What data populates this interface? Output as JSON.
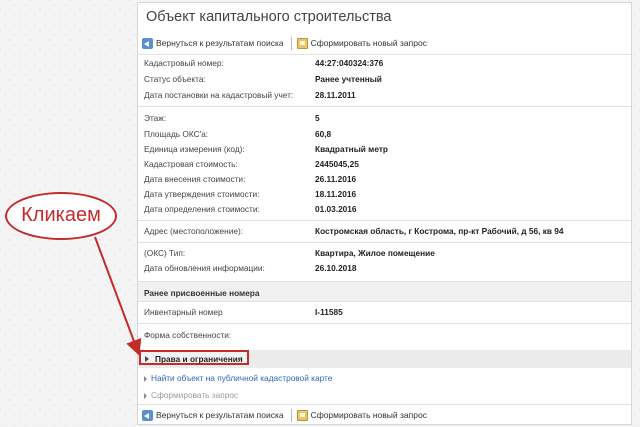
{
  "panel": {
    "title": "Объект капитального строительства"
  },
  "toolbar": {
    "back_label": "Вернуться к результатам поиска",
    "new_query_label": "Сформировать новый запрос"
  },
  "fields": {
    "cadastral_number": {
      "label": "Кадастровый номер:",
      "value": "44:27:040324:376"
    },
    "object_status": {
      "label": "Статус объекта:",
      "value": "Ранее учтенный"
    },
    "registration_date": {
      "label": "Дата постановки на кадастровый учет:",
      "value": "28.11.2011"
    },
    "floor": {
      "label": "Этаж:",
      "value": "5"
    },
    "area": {
      "label": "Площадь ОКС'a:",
      "value": "60,8"
    },
    "unit": {
      "label": "Единица измерения (код):",
      "value": "Квадратный метр"
    },
    "cadastral_value": {
      "label": "Кадастровая стоимость:",
      "value": "2445045,25"
    },
    "value_entry_date": {
      "label": "Дата внесения стоимости:",
      "value": "26.11.2016"
    },
    "value_approval_date": {
      "label": "Дата утверждения стоимости:",
      "value": "18.11.2016"
    },
    "value_determination_date": {
      "label": "Дата определения стоимости:",
      "value": "01.03.2016"
    },
    "address": {
      "label": "Адрес (местоположение):",
      "value": "Костромская область, г Кострома, пр-кт Рабочий, д 56, кв 94"
    },
    "oks_type": {
      "label": "(ОКС) Тип:",
      "value": "Квартира, Жилое помещение"
    },
    "info_update_date": {
      "label": "Дата обновления информации:",
      "value": "26.10.2018"
    }
  },
  "previous_numbers": {
    "heading": "Ранее присвоенные номера",
    "inventory_label": "Инвентарный номер",
    "inventory_value": "I-11585"
  },
  "ownership": {
    "label": "Форма собственности:"
  },
  "rights": {
    "label": "Права и ограничения"
  },
  "links": {
    "public_map": "Найти объект на публичной кадастровой карте",
    "request": "Сформировать запрос"
  },
  "callout": {
    "text": "Кликаем"
  },
  "colors": {
    "callout_red": "#c42b2b",
    "link_blue": "#2f68b8"
  }
}
